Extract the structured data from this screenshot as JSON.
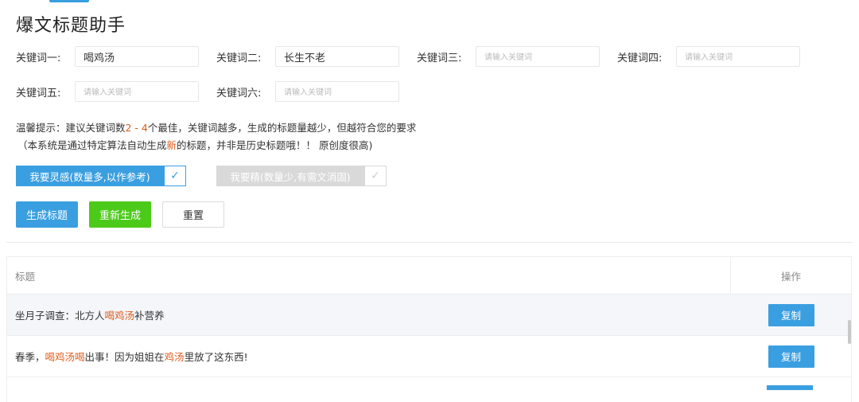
{
  "page": {
    "title": "爆文标题助手"
  },
  "keywords": [
    {
      "label": "关键词一:",
      "value": "喝鸡汤",
      "placeholder": "请输入关键词"
    },
    {
      "label": "关键词二:",
      "value": "长生不老",
      "placeholder": "请输入关键词"
    },
    {
      "label": "关键词三:",
      "value": "",
      "placeholder": "请输入关键词"
    },
    {
      "label": "关键词四:",
      "value": "",
      "placeholder": "请输入关键词"
    },
    {
      "label": "关键词五:",
      "value": "",
      "placeholder": "请输入关键词"
    },
    {
      "label": "关键词六:",
      "value": "",
      "placeholder": "请输入关键词"
    }
  ],
  "tips": {
    "line1_prefix": "温馨提示：建议关键词数",
    "line1_range": "2 - 4",
    "line1_suffix": "个最佳，关键词越多，生成的标题量越少，但越符合您的要求",
    "line2_prefix": "（本系统是通过特定算法自动生成",
    "line2_highlight": "新",
    "line2_suffix": "的标题，并非是历史标题哦！！ 原创度很高)"
  },
  "modes": {
    "inspiration": {
      "label": "我要灵感(数量多,以作参考)",
      "checked": true
    },
    "precise": {
      "label": "我要精(数量少,有需文消固)",
      "checked": true
    }
  },
  "actions": {
    "generate": "生成标题",
    "regenerate": "重新生成",
    "reset": "重置"
  },
  "table": {
    "columns": [
      "标题",
      "操作"
    ],
    "rows": [
      {
        "parts": [
          "坐月子调查：北方人",
          "喝鸡汤",
          "补营养",
          "",
          ""
        ],
        "copy_label": "复制"
      },
      {
        "parts": [
          "春季，",
          "喝鸡汤喝",
          "出事！因为姐姐在",
          "鸡汤",
          "里放了这东西!"
        ],
        "copy_label": "复制"
      }
    ]
  },
  "colors": {
    "primary": "#3a9fe0",
    "success": "#4cca1a",
    "highlight": "#e05a1b",
    "disabled": "#d9d9d9"
  }
}
